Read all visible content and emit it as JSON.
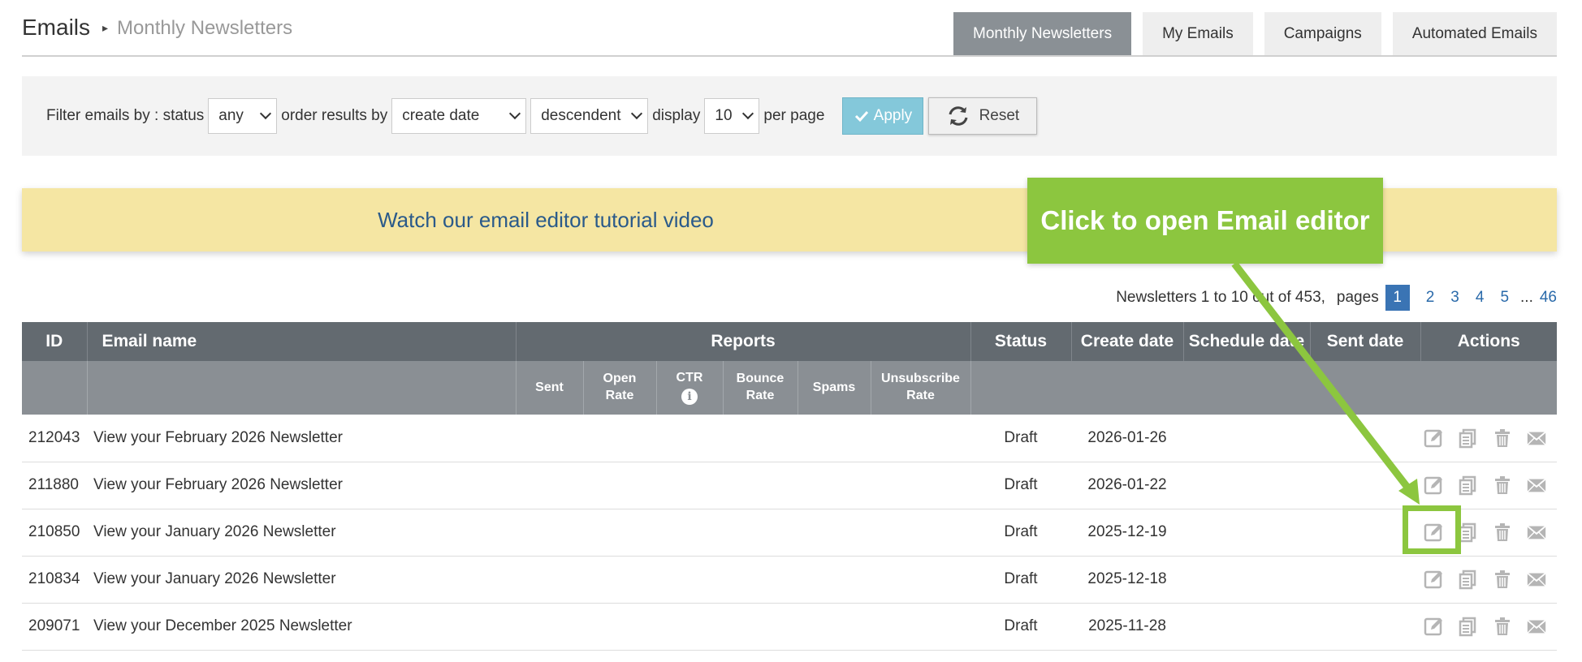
{
  "breadcrumb": {
    "main": "Emails",
    "separator": "▸",
    "sub": "Monthly Newsletters"
  },
  "tabs": [
    {
      "label": "Monthly Newsletters",
      "active": true
    },
    {
      "label": "My Emails",
      "active": false
    },
    {
      "label": "Campaigns",
      "active": false
    },
    {
      "label": "Automated Emails",
      "active": false
    }
  ],
  "filter": {
    "label_status": "Filter emails by : status",
    "status_value": "any",
    "label_order": "order results by",
    "order_value": "create date",
    "direction_value": "descendent",
    "label_display": "display",
    "display_value": "10",
    "label_per_page": "per page",
    "apply_label": "Apply",
    "reset_label": "Reset"
  },
  "banner": {
    "text": "Watch our email editor tutorial video"
  },
  "callout": {
    "text": "Click to open Email editor",
    "color": "#8cc63f"
  },
  "pagination": {
    "summary": "Newsletters 1 to 10 out of 453,",
    "pages_label": "pages",
    "pages": [
      "1",
      "2",
      "3",
      "4",
      "5"
    ],
    "ellipsis": "...",
    "last": "46",
    "current": "1"
  },
  "table": {
    "headers": {
      "id": "ID",
      "name": "Email name",
      "reports": "Reports",
      "status": "Status",
      "create_date": "Create date",
      "schedule_date": "Schedule date",
      "sent_date": "Sent date",
      "actions": "Actions"
    },
    "sub_headers": {
      "sent": "Sent",
      "open_rate_1": "Open",
      "open_rate_2": "Rate",
      "ctr": "CTR",
      "bounce_1": "Bounce",
      "bounce_2": "Rate",
      "spams": "Spams",
      "unsub_1": "Unsubscribe",
      "unsub_2": "Rate"
    },
    "rows": [
      {
        "id": "212043",
        "name": "View your February 2026 Newsletter",
        "status": "Draft",
        "create_date": "2026-01-26"
      },
      {
        "id": "211880",
        "name": "View your February 2026 Newsletter",
        "status": "Draft",
        "create_date": "2026-01-22"
      },
      {
        "id": "210850",
        "name": "View your January 2026 Newsletter",
        "status": "Draft",
        "create_date": "2025-12-19"
      },
      {
        "id": "210834",
        "name": "View your January 2026 Newsletter",
        "status": "Draft",
        "create_date": "2025-12-18"
      },
      {
        "id": "209071",
        "name": "View your December 2025 Newsletter",
        "status": "Draft",
        "create_date": "2025-11-28"
      }
    ],
    "action_icons": [
      "edit-icon",
      "copy-icon",
      "trash-icon",
      "envelope-icon"
    ]
  },
  "colors": {
    "accent": "#8cc63f",
    "link": "#2a6aaa",
    "status_draft": "#3a9a2a",
    "header_dark": "#636a70",
    "header_light": "#8a8f94"
  }
}
